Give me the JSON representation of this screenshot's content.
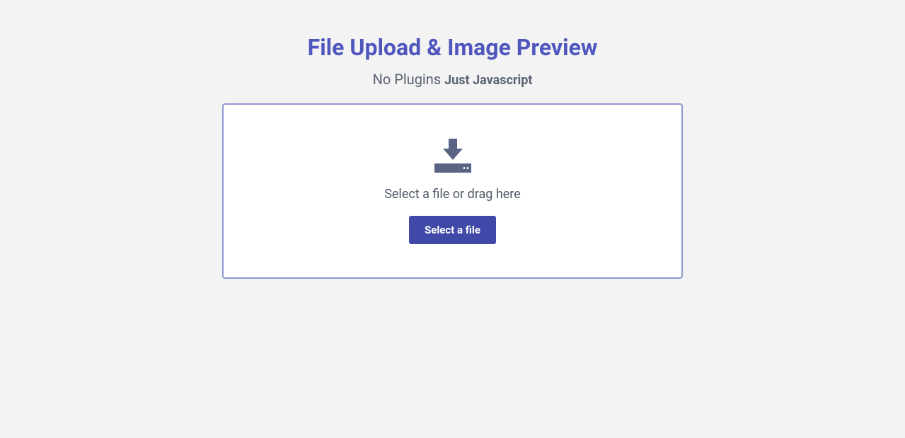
{
  "header": {
    "title": "File Upload & Image Preview",
    "subtitle_plain": "No Plugins ",
    "subtitle_bold": "Just Javascript"
  },
  "upload": {
    "instruction": "Select a file or drag here",
    "button_label": "Select a file",
    "icon": "download-icon"
  },
  "colors": {
    "accent": "#4f56bd",
    "button_bg": "#4049a8",
    "border": "#9097d2",
    "icon": "#5a6586",
    "text_muted": "#5a6472",
    "bg": "#f3f3f3"
  }
}
